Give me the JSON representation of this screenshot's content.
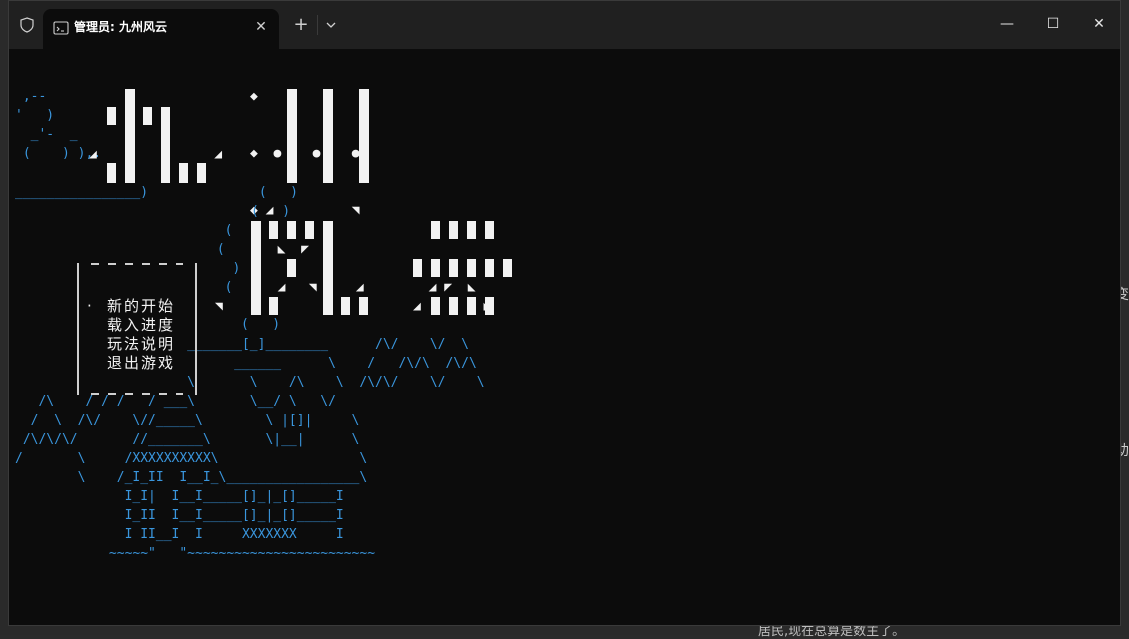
{
  "window": {
    "tab_title": "管理员: 九州风云",
    "tab_close": "✕",
    "new_tab": "+",
    "btn_min": "—",
    "btn_max": "☐",
    "btn_close": "✕"
  },
  "background": {
    "peek_text_1": "变",
    "peek_text_2": "助",
    "peek_text_3": "居民,现在总算是数主了。"
  },
  "game_menu": {
    "cursor": "·",
    "items": [
      "新的开始",
      "载入进度",
      "玩法说明",
      "退出游戏"
    ],
    "selected_index": 0
  },
  "colors": {
    "ascii_blue": "#3a96dd",
    "ascii_white": "#f2f2f2",
    "console_bg": "#0c0c0c",
    "titlebar_bg": "#202020"
  },
  "icons": [
    "shield-icon",
    "terminal-icon",
    "close-icon",
    "plus-icon",
    "chevron-down-icon",
    "minimize-icon",
    "maximize-icon"
  ]
}
